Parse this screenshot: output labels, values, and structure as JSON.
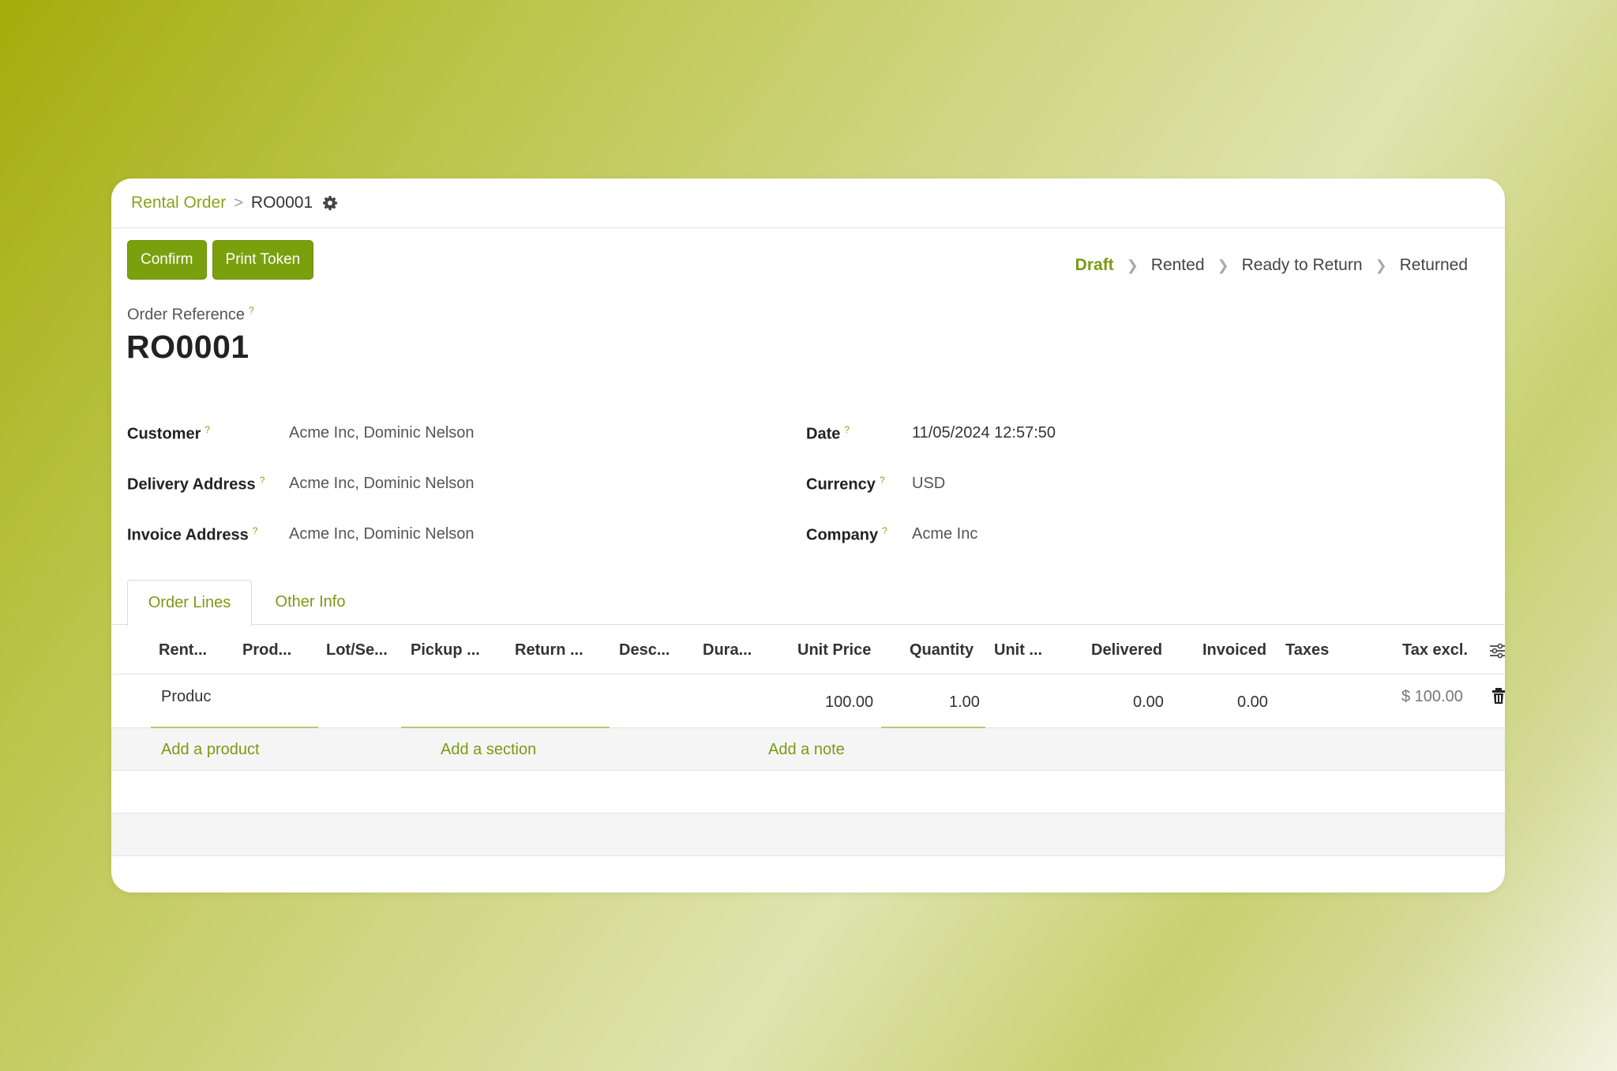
{
  "breadcrumb": {
    "parent": "Rental Order",
    "current": "RO0001",
    "separator": ">"
  },
  "actions": {
    "confirm": "Confirm",
    "print_token": "Print Token"
  },
  "status_bar": {
    "stages": [
      "Draft",
      "Rented",
      "Ready to Return",
      "Returned"
    ],
    "active": "Draft"
  },
  "form": {
    "order_reference_label": "Order Reference",
    "order_reference": "RO0001",
    "help_mark": "?",
    "customer_label": "Customer",
    "customer": "Acme Inc, Dominic Nelson",
    "delivery_address_label": "Delivery Address",
    "delivery_address": "Acme Inc, Dominic Nelson",
    "invoice_address_label": "Invoice Address",
    "invoice_address": "Acme Inc, Dominic Nelson",
    "date_label": "Date",
    "date": "11/05/2024 12:57:50",
    "currency_label": "Currency",
    "currency": "USD",
    "company_label": "Company",
    "company": "Acme Inc"
  },
  "tabs": [
    "Order Lines",
    "Other Info"
  ],
  "table": {
    "columns": [
      "Rent...",
      "Prod...",
      "Lot/Se...",
      "Pickup ...",
      "Return ...",
      "Desc...",
      "Dura...",
      "Unit Price",
      "Quantity",
      "Unit ...",
      "Delivered",
      "Invoiced",
      "Taxes",
      "Tax excl."
    ],
    "row": {
      "rental": "Produc",
      "unit_price": "100.00",
      "quantity": "1.00",
      "delivered": "0.00",
      "invoiced": "0.00",
      "tax_excl": "$ 100.00"
    },
    "add_product": "Add a product",
    "add_section": "Add a section",
    "add_note": "Add a note"
  },
  "icons": {
    "settings": "gear-icon",
    "column_options": "sliders-icon",
    "delete": "trash-icon"
  },
  "colors": {
    "accent": "#7ba00e",
    "link": "#7a9a14"
  }
}
